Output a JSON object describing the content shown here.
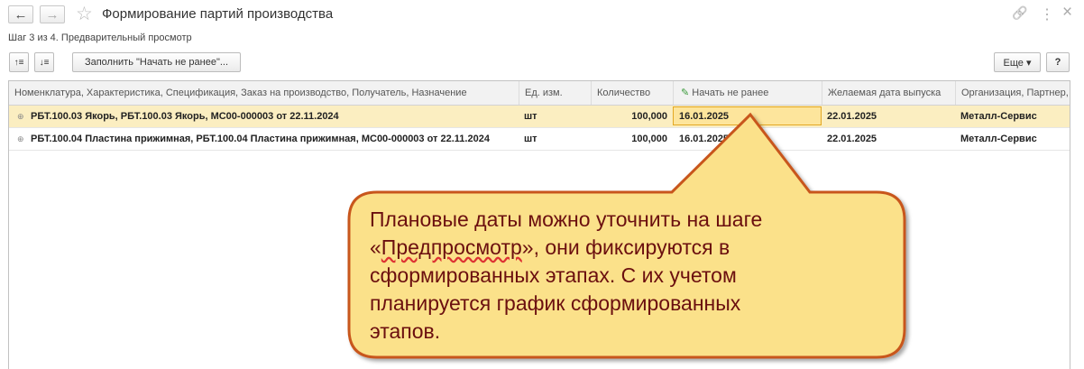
{
  "header": {
    "title": "Формирование партий производства",
    "back_icon": "←",
    "forward_icon": "→",
    "star_icon": "☆",
    "link_icon": "🔗",
    "menu_icon": "⋮",
    "close_icon": "×"
  },
  "step": "Шаг 3 из 4. Предварительный просмотр",
  "toolbar": {
    "sort_up_icon": "↑≡",
    "sort_down_icon": "↓≡",
    "fill_button": "Заполнить \"Начать не ранее\"...",
    "more_button": "Еще ▾",
    "help_button": "?"
  },
  "table": {
    "columns": [
      "Номенклатура, Характеристика, Спецификация, Заказ на производство, Получатель, Назначение",
      "Ед. изм.",
      "Количество",
      "Начать не ранее",
      "Желаемая дата выпуска",
      "Организация, Партнер,"
    ],
    "edit_icon": "✎",
    "rows": [
      {
        "expander": "⊕",
        "name": "РБТ.100.03 Якорь, РБТ.100.03 Якорь, МС00-000003 от 22.11.2024",
        "unit": "шт",
        "qty": "100,000",
        "start": "16.01.2025",
        "desired": "22.01.2025",
        "org": "Металл-Сервис"
      },
      {
        "expander": "⊕",
        "name": "РБТ.100.04 Пластина прижимная, РБТ.100.04 Пластина прижимная, МС00-000003 от 22.11.2024",
        "unit": "шт",
        "qty": "100,000",
        "start": "16.01.2025",
        "desired": "22.01.2025",
        "org": "Металл-Сервис"
      }
    ]
  },
  "callout": {
    "line1": "Плановые даты можно уточнить на шаге",
    "line2_open": "«",
    "line2_word": "Предпросмотр",
    "line2_rest": "», они фиксируются в",
    "line3": "сформированных этапах. С их учетом",
    "line4": "планируется график сформированных",
    "line5": "этапов.",
    "fill_color": "#fbe18a",
    "border_color": "#c8571e",
    "text_color": "#6b0f0f"
  }
}
